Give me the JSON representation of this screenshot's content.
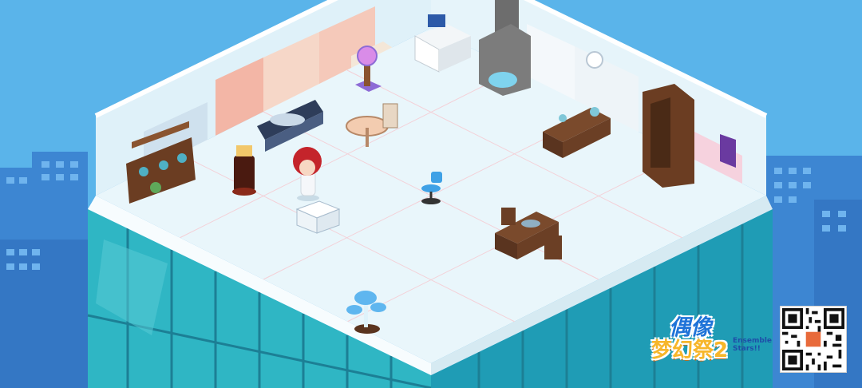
{
  "title": {
    "idol": "偶像",
    "dream_fest": "梦幻祭2",
    "ensemble": "Ensemble",
    "stars": "Stars!!"
  },
  "colors": {
    "sky": "#5ab4ea",
    "floor": "#e9f6fb",
    "glass_building": "#2fb6c4",
    "logo_blue": "#1e73d8",
    "logo_gold": "#f7b62a"
  },
  "room_items": [
    {
      "name": "blue-display-shelf",
      "icon": "shelf"
    },
    {
      "name": "chaise-lounge",
      "icon": "sofa"
    },
    {
      "name": "crystal-ball-pedestal",
      "icon": "crystal-ball"
    },
    {
      "name": "white-desk-with-binders",
      "icon": "desk"
    },
    {
      "name": "stone-fireplace",
      "icon": "fireplace"
    },
    {
      "name": "round-tea-table",
      "icon": "table"
    },
    {
      "name": "alchemy-desk",
      "icon": "desk"
    },
    {
      "name": "tall-bookcase",
      "icon": "bookcase"
    },
    {
      "name": "lantern-stand",
      "icon": "lantern"
    },
    {
      "name": "blue-office-chair",
      "icon": "chair"
    },
    {
      "name": "small-white-table",
      "icon": "table"
    },
    {
      "name": "writing-desk-with-chairs",
      "icon": "desk"
    },
    {
      "name": "glowing-mushroom-pot",
      "icon": "mushroom"
    },
    {
      "name": "poster",
      "icon": "poster"
    }
  ],
  "character": {
    "name": "red-haired-idol",
    "icon": "avatar"
  }
}
